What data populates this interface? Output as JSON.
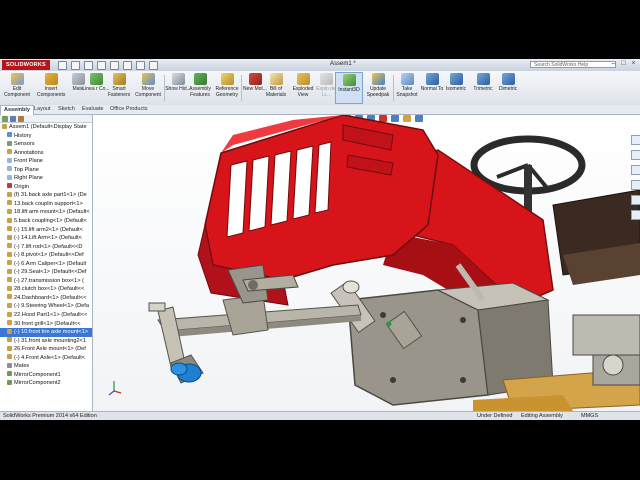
{
  "app": {
    "logo": "SOLIDWORKS",
    "document_title": "Assem1 *",
    "search_placeholder": "Search SolidWorks Help"
  },
  "toolbar": {
    "buttons": [
      {
        "label": "Edit Component",
        "icon": "edit-component-icon"
      },
      {
        "label": "Insert Components",
        "icon": "insert-components-icon"
      },
      {
        "label": "Mate",
        "icon": "mate-icon"
      },
      {
        "label": "Linea r Co...",
        "icon": "linear-pattern-icon"
      },
      {
        "label": "Smart Fasteners",
        "icon": "smart-fasteners-icon"
      },
      {
        "label": "Move Component",
        "icon": "move-component-icon"
      },
      {
        "label": "Show Hid...",
        "icon": "show-hidden-icon"
      },
      {
        "label": "Assembly Features",
        "icon": "assembly-features-icon"
      },
      {
        "label": "Reference Geometry",
        "icon": "reference-geometry-icon"
      },
      {
        "label": "New Mot...",
        "icon": "new-motion-study-icon"
      },
      {
        "label": "Bill of Materials",
        "icon": "bill-of-materials-icon"
      },
      {
        "label": "Exploded View",
        "icon": "exploded-view-icon"
      },
      {
        "label": "Explo de Li...",
        "icon": "explode-line-icon"
      },
      {
        "label": "Instant3D",
        "icon": "instant3d-icon"
      },
      {
        "label": "Update Speedpak",
        "icon": "update-speedpak-icon"
      },
      {
        "label": "Take Snapshot",
        "icon": "take-snapshot-icon"
      },
      {
        "label": "Normal To",
        "icon": "normal-to-icon"
      },
      {
        "label": "Isometric",
        "icon": "isometric-icon"
      },
      {
        "label": "Trimetric",
        "icon": "trimetric-icon"
      },
      {
        "label": "Dimetric",
        "icon": "dimetric-icon"
      }
    ]
  },
  "tabs": [
    "Assembly",
    "Layout",
    "Sketch",
    "Evaluate",
    "Office Products"
  ],
  "tree": {
    "items": [
      "Assem1  (Default<Display State",
      "History",
      "Sensors",
      "Annotations",
      "Front Plane",
      "Top Plane",
      "Right Plane",
      "Origin",
      "(f) 31.back axle part1<1> (De",
      "13.back couplin support<1>",
      "18.lift arm mount<1> (Default<",
      "5.back coupling<1> (Default<",
      "(-) 15.lift arm2<1> (Default<",
      "(-) 14.Lift Arm<1> (Default<",
      "(-) 7.lift rod<1> (Default<<D",
      "(-) 8.pivot<1> (Default<<Def",
      "(-) 6.Arm Caliper<1> (Default",
      "(-) 29.Seat<1> (Default<<Def",
      "(-) 27.transmission box<1> (",
      "28.clutch box<1> (Default<<",
      "24.Dashboard<1> (Default<<",
      "(-) 9.Steering Wheel<1> (Defa",
      "22.Hood Part1<1> (Default<<",
      "30.front grill<1> (Default<<",
      "(-) 10.front tire axle mount<1>",
      "(-) 31.front axle mounting2<1",
      "26.Front Axle mount<1> (Def",
      "(-) 4.Front Axle<1> (Default<",
      "Mates",
      "MirrorComponent1",
      "MirrorComponent2"
    ],
    "selected_index": 24
  },
  "status": {
    "edition": "SolidWorks Premium 2014 x64 Edition",
    "definition": "Under Defined",
    "mode": "Editing Assembly",
    "units": "MMGS"
  },
  "colors": {
    "hood_red": "#d8141b",
    "metal_gray": "#9a958a",
    "axle_blue": "#1f7fd0",
    "selection_blue": "#3b78d6",
    "brand_red": "#b5161b"
  }
}
